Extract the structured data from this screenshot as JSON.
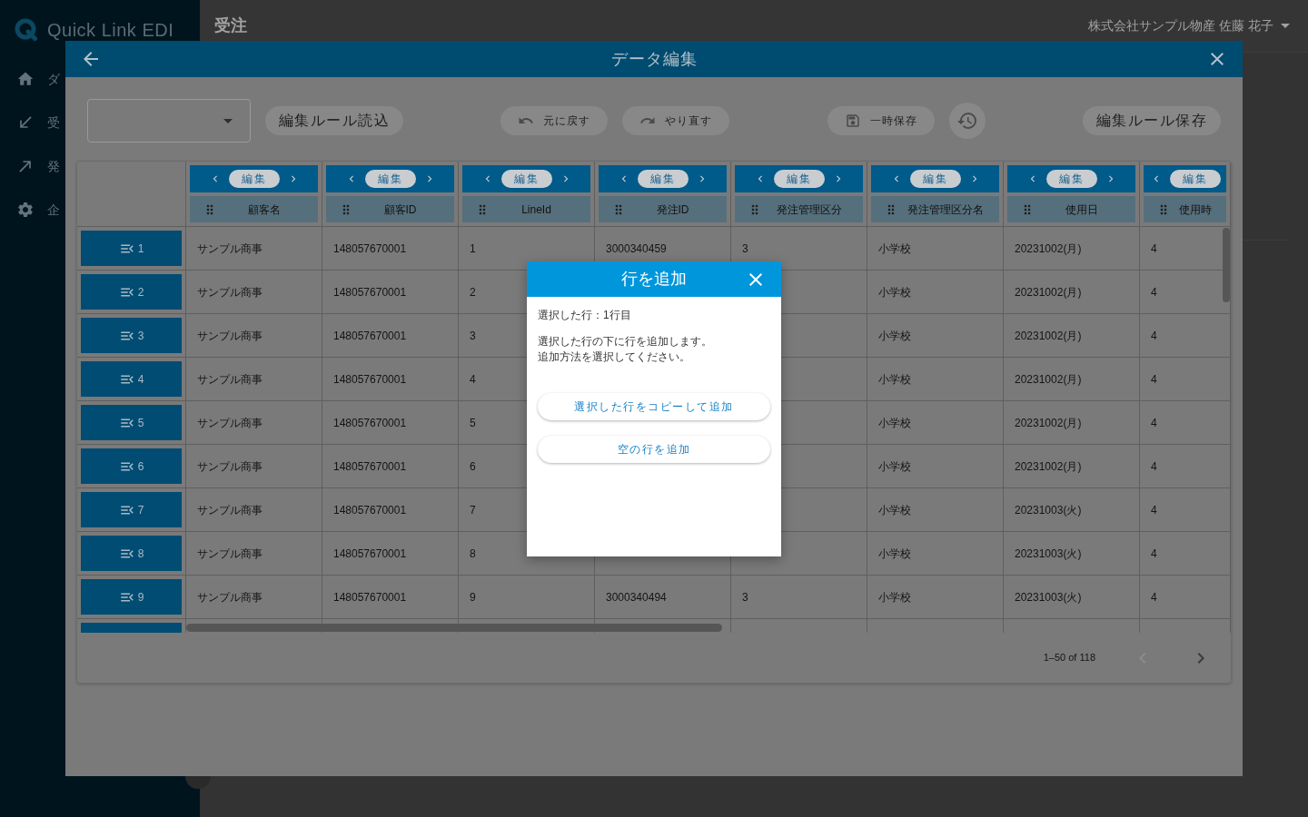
{
  "sidebar": {
    "logo": "Quick Link EDI",
    "items": [
      {
        "label": "ダ"
      },
      {
        "label": "受"
      },
      {
        "label": "発"
      },
      {
        "label": "企"
      }
    ]
  },
  "header": {
    "title": "受注",
    "user": "株式会社サンプル物産 佐藤 花子"
  },
  "editor": {
    "title": "データ編集",
    "toolbar": {
      "groups": [
        [
          {
            "kind": "text",
            "label": "編集ルール読込",
            "disabled": true
          }
        ],
        [
          {
            "kind": "icon_text",
            "label": "元に戻す",
            "disabled": true
          },
          {
            "kind": "icon_text",
            "label": "やり直す",
            "disabled": true
          }
        ],
        [
          {
            "kind": "icon_text",
            "label": "一時保存",
            "disabled": true
          },
          {
            "kind": "icon",
            "disabled": true
          }
        ],
        [
          {
            "kind": "text",
            "label": "編集ルール保存",
            "disabled": true
          }
        ]
      ]
    },
    "table": {
      "columns": [
        {
          "name": "顧客名",
          "edit": "編集"
        },
        {
          "name": "顧客ID",
          "edit": "編集"
        },
        {
          "name": "LineId",
          "edit": "編集"
        },
        {
          "name": "発注ID",
          "edit": "編集"
        },
        {
          "name": "発注管理区分",
          "edit": "編集"
        },
        {
          "name": "発注管理区分名",
          "edit": "編集"
        },
        {
          "name": "使用日",
          "edit": "編集"
        },
        {
          "name": "使用時",
          "edit": "編集"
        }
      ],
      "rows": [
        {
          "number": "1",
          "cells": [
            "サンプル商事",
            "148057670001",
            "1",
            "3000340459",
            "3",
            "小学校",
            "20231002(月)",
            "4"
          ]
        },
        {
          "number": "2",
          "cells": [
            "サンプル商事",
            "148057670001",
            "2",
            null,
            null,
            "小学校",
            "20231002(月)",
            "4"
          ]
        },
        {
          "number": "3",
          "cells": [
            "サンプル商事",
            "148057670001",
            "3",
            null,
            null,
            "小学校",
            "20231002(月)",
            "4"
          ]
        },
        {
          "number": "4",
          "cells": [
            "サンプル商事",
            "148057670001",
            "4",
            null,
            null,
            "小学校",
            "20231002(月)",
            "4"
          ]
        },
        {
          "number": "5",
          "cells": [
            "サンプル商事",
            "148057670001",
            "5",
            null,
            null,
            "小学校",
            "20231002(月)",
            "4"
          ]
        },
        {
          "number": "6",
          "cells": [
            "サンプル商事",
            "148057670001",
            "6",
            null,
            null,
            "小学校",
            "20231002(月)",
            "4"
          ]
        },
        {
          "number": "7",
          "cells": [
            "サンプル商事",
            "148057670001",
            "7",
            null,
            null,
            "小学校",
            "20231003(火)",
            "4"
          ]
        },
        {
          "number": "8",
          "cells": [
            "サンプル商事",
            "148057670001",
            "8",
            null,
            null,
            "小学校",
            "20231003(火)",
            "4"
          ]
        },
        {
          "number": "9",
          "cells": [
            "サンプル商事",
            "148057670001",
            "9",
            "3000340494",
            "3",
            "小学校",
            "20231003(火)",
            "4"
          ]
        }
      ],
      "more_rows": true
    },
    "pagination": {
      "range": "1–50 of 118",
      "prev_disabled": true,
      "next_disabled": false
    }
  },
  "add_row_dialog": {
    "title": "行を追加",
    "selected_row": "選択した行：1行目",
    "message": [
      "選択した行の下に行を追加します。",
      "追加方法を選択してください。"
    ],
    "actions": [
      {
        "label": "選択した行をコピーして追加"
      },
      {
        "label": "空の行を追加"
      }
    ]
  }
}
